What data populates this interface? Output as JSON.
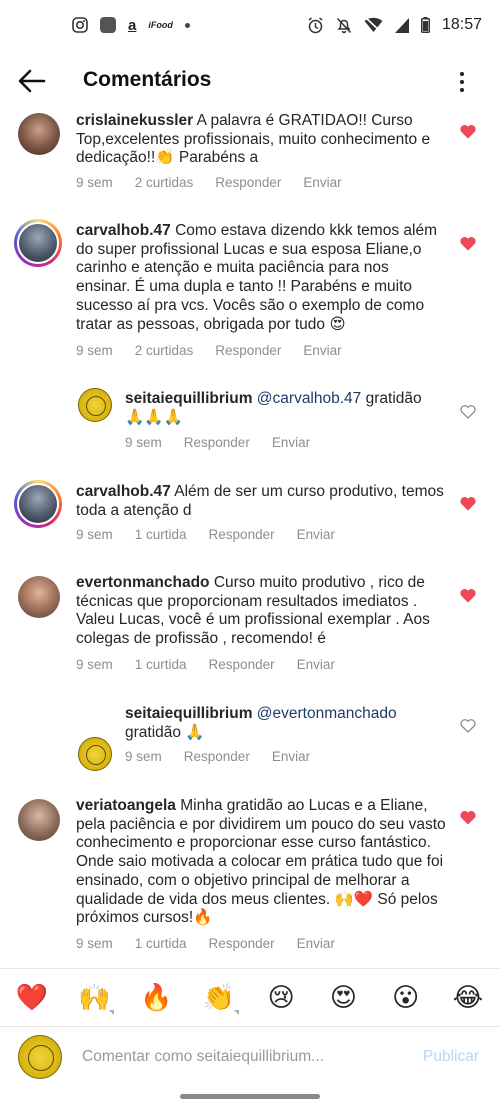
{
  "status_bar": {
    "time": "18:57",
    "left_icons": [
      "instagram-icon",
      "app-icon",
      "amazon-icon",
      "ifood-icon",
      "dot-icon"
    ],
    "amazon_glyph": "a",
    "ifood_glyph": "iFood",
    "right_icons": [
      "alarm-icon",
      "mute-icon",
      "wifi-icon",
      "signal-icon",
      "battery-icon"
    ]
  },
  "header": {
    "title": "Comentários"
  },
  "comments": [
    {
      "username": "crislainekussler",
      "text": "A palavra é GRATIDAO!! Curso Top,excelentes profissionais, muito conhecimento e dedicação!!👏 Parabéns a",
      "time": "9 sem",
      "likes": "2 curtidas",
      "reply": "Responder",
      "send": "Enviar",
      "liked": true
    },
    {
      "username": "carvalhob.47",
      "text": "Como estava dizendo kkk temos além do super profissional Lucas e sua esposa Eliane,o carinho e atenção e muita paciência para nos ensinar. É uma dupla e tanto !! Parabéns e muito sucesso aí pra vcs. Vocês são o exemplo de como tratar as pessoas, obrigada por tudo 😍",
      "time": "9 sem",
      "likes": "2 curtidas",
      "reply": "Responder",
      "send": "Enviar",
      "liked": true
    },
    {
      "username": "seitaiequillibrium",
      "mention": "@carvalhob.47",
      "text": "gratidão 🙏🙏🙏",
      "time": "9 sem",
      "reply": "Responder",
      "send": "Enviar",
      "liked": false
    },
    {
      "username": "carvalhob.47",
      "text": "Além de ser um curso produtivo, temos toda a atenção d",
      "time": "9 sem",
      "likes": "1 curtida",
      "reply": "Responder",
      "send": "Enviar",
      "liked": true
    },
    {
      "username": "evertonmanchado",
      "text": "Curso muito produtivo , rico de técnicas que proporcionam resultados imediatos . Valeu Lucas, você é um profissional exemplar . Aos colegas de profissão , recomendo! é",
      "time": "9 sem",
      "likes": "1 curtida",
      "reply": "Responder",
      "send": "Enviar",
      "liked": true
    },
    {
      "username": "seitaiequillibrium",
      "mention": "@evertonmanchado",
      "text": "gratidão 🙏",
      "time": "9 sem",
      "reply": "Responder",
      "send": "Enviar",
      "liked": false
    },
    {
      "username": "veriatoangela",
      "text": "Minha gratidão ao Lucas e a Eliane, pela paciência e por dividirem um pouco do seu vasto conhecimento e proporcionar esse curso fantástico. Onde saio motivada a colocar em prática tudo que foi ensinado,  com o objetivo principal de melhorar a qualidade de vida dos meus clientes. 🙌❤️ Só pelos próximos cursos!🔥",
      "time": "9 sem",
      "likes": "1 curtida",
      "reply": "Responder",
      "send": "Enviar",
      "liked": true
    }
  ],
  "reactions": [
    "❤️",
    "🙌",
    "🔥",
    "👏",
    "😢",
    "😍",
    "😮",
    "😂"
  ],
  "composer": {
    "placeholder": "Comentar como seitaiequillibrium...",
    "publish_label": "Publicar"
  },
  "colors": {
    "heart_red": "#ed4956",
    "link_blue": "#1f3a66",
    "meta_gray": "#8e8e8e",
    "publish_disabled": "#b3d6f7"
  }
}
